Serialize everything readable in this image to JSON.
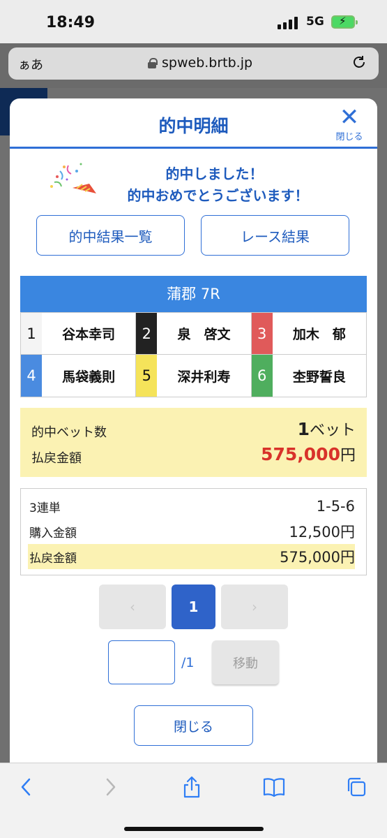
{
  "status_bar": {
    "time": "18:49",
    "network": "5G"
  },
  "browser": {
    "text_size_label": "ぁあ",
    "url": "spweb.brtb.jp"
  },
  "modal": {
    "title": "的中明細",
    "close_label": "閉じる",
    "congrats_line1": "的中しました！",
    "congrats_line2": "的中おめでとうございます！",
    "hit_results_button": "的中結果一覧",
    "race_results_button": "レース結果",
    "race_title": "蒲郡 7R",
    "racers": [
      {
        "lane": "1",
        "name": "谷本幸司",
        "bg": "#f4f4f4",
        "fg": "#111111"
      },
      {
        "lane": "2",
        "name": "泉　啓文",
        "bg": "#222222",
        "fg": "#ffffff"
      },
      {
        "lane": "3",
        "name": "加木　郁",
        "bg": "#e05a5a",
        "fg": "#ffffff"
      },
      {
        "lane": "4",
        "name": "馬袋義則",
        "bg": "#4a8be0",
        "fg": "#ffffff"
      },
      {
        "lane": "5",
        "name": "深井利寿",
        "bg": "#f5e35a",
        "fg": "#111111"
      },
      {
        "lane": "6",
        "name": "杢野誓良",
        "bg": "#4fae5e",
        "fg": "#ffffff"
      }
    ],
    "summary": {
      "bet_count_label": "的中ベット数",
      "bet_count_value": "1",
      "bet_count_unit": "ベット",
      "payout_label": "払戻金額",
      "payout_value": "575,000",
      "payout_unit": "円"
    },
    "detail": {
      "bet_type": "3連単",
      "combination": "1-5-6",
      "purchase_label": "購入金額",
      "purchase_value": "12,500円",
      "payout_label": "払戻金額",
      "payout_value": "575,000円"
    },
    "pager": {
      "prev": "‹",
      "current": "1",
      "next": "›",
      "total": "/1",
      "move_label": "移動"
    },
    "close_button": "閉じる"
  },
  "colors": {
    "accent": "#2f6fd6",
    "title_blue": "#1e5bbd",
    "race_header": "#3a86e0",
    "highlight": "#fbf2b3",
    "payout_red": "#d8322a"
  },
  "icons": [
    "signal-icon",
    "battery-icon",
    "lock-icon",
    "reload-icon",
    "close-icon",
    "party-popper-icon",
    "back-icon",
    "forward-icon",
    "share-icon",
    "bookmarks-icon",
    "tabs-icon"
  ]
}
